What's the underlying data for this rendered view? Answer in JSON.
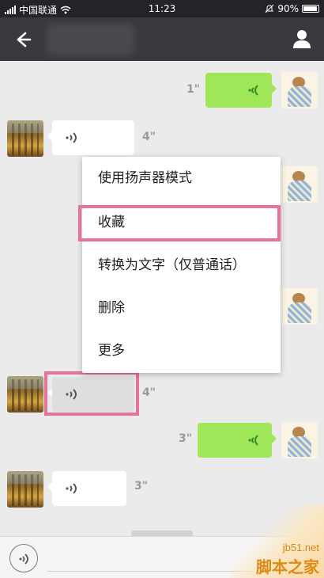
{
  "statusbar": {
    "carrier": "中国联通",
    "time": "11:23",
    "battery": "90%"
  },
  "header": {
    "back_icon": "arrow-left-icon",
    "profile_icon": "person-icon"
  },
  "messages": [
    {
      "direction": "out",
      "type": "voice",
      "duration": "1\""
    },
    {
      "direction": "in",
      "type": "voice",
      "duration": "4\""
    },
    {
      "direction": "in",
      "type": "voice",
      "duration": "4\"",
      "selected": true
    },
    {
      "direction": "out",
      "type": "voice",
      "duration": "3\""
    },
    {
      "direction": "in",
      "type": "voice",
      "duration": "3\""
    }
  ],
  "context_menu": {
    "items": [
      {
        "label": "使用扬声器模式"
      },
      {
        "label": "收藏",
        "highlighted": true
      },
      {
        "label": "转换为文字（仅普通话）"
      },
      {
        "label": "删除"
      },
      {
        "label": "更多"
      }
    ]
  },
  "colors": {
    "outgoing_bubble": "#9fe658",
    "highlight": "#e8739a",
    "header": "#393a3f"
  },
  "watermark": {
    "url": "jb51.net",
    "brand": "脚本之家"
  }
}
